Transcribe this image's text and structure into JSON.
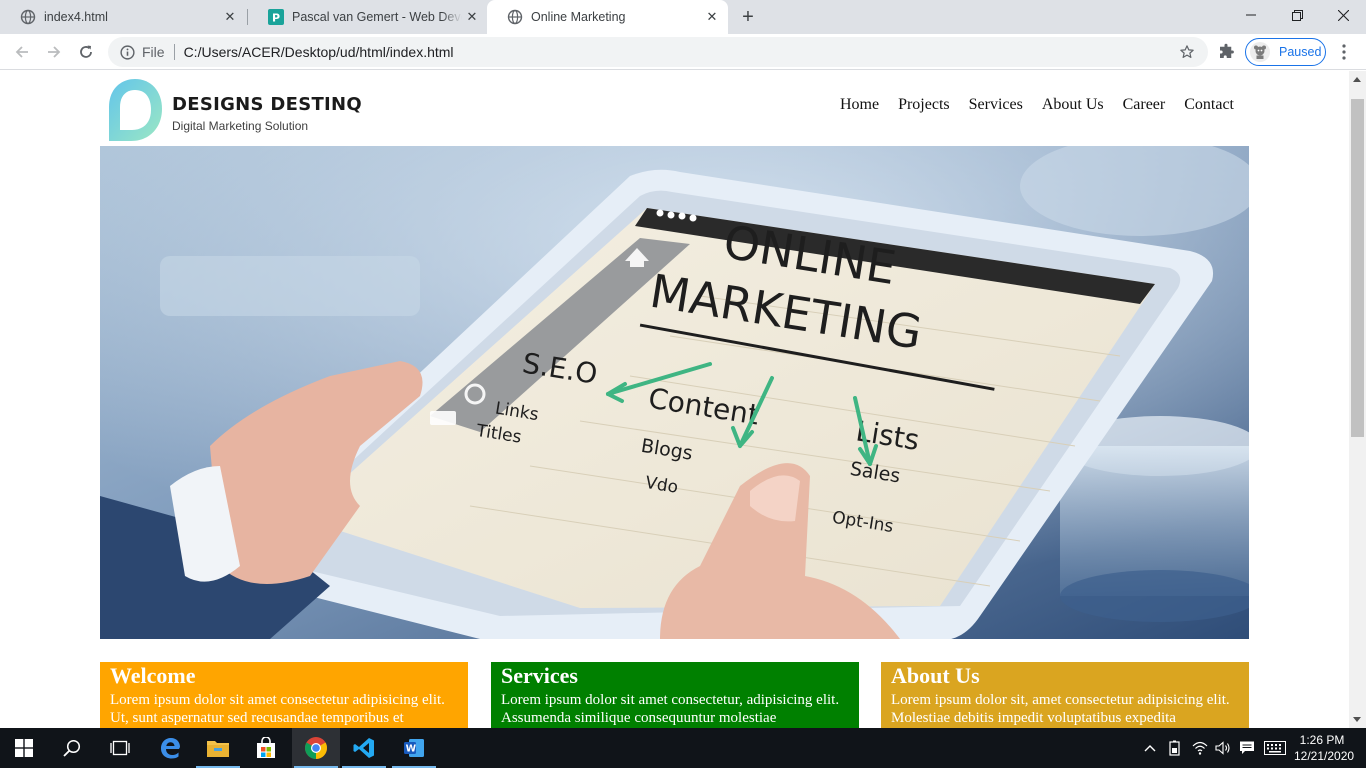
{
  "browser": {
    "tabs": [
      {
        "title": "index4.html",
        "icon": "globe-icon",
        "active": false
      },
      {
        "title": "Pascal van Gemert - Web Develop",
        "icon": "p-favicon-icon",
        "active": false
      },
      {
        "title": "Online Marketing",
        "icon": "globe-icon",
        "active": true
      }
    ],
    "new_tab_label": "+",
    "omnibox": {
      "scheme_label": "File",
      "url": "C:/Users/ACER/Desktop/ud/html/index.html"
    },
    "profile_label": "Paused",
    "colors": {
      "tabstrip": "#dee1e6",
      "accent": "#1a73e8"
    }
  },
  "site": {
    "logo": {
      "name": "DESIGNS DESTINQ",
      "tagline": "Digital Marketing Solution",
      "colors": [
        "#6fc7e8",
        "#8ee5c2"
      ]
    },
    "nav": [
      "Home",
      "Projects",
      "Services",
      "About Us",
      "Career",
      "Contact"
    ],
    "hero": {
      "heading": [
        "ONLINE",
        "MARKETING"
      ],
      "branches": [
        "S.E.O",
        "Content",
        "Lists"
      ],
      "sub_items": [
        "Links",
        "Titles",
        "Blogs",
        "Vdo",
        "Sales",
        "Opt-Ins"
      ]
    },
    "boxes": [
      {
        "title": "Welcome",
        "text": "Lorem ipsum dolor sit amet consectetur adipisicing elit. Ut, sunt aspernatur sed recusandae temporibus et",
        "color": "#ffa500"
      },
      {
        "title": "Services",
        "text": "Lorem ipsum dolor sit amet consectetur, adipisicing elit. Assumenda similique consequuntur molestiae",
        "color": "#008000"
      },
      {
        "title": "About Us",
        "text": "Lorem ipsum dolor sit, amet consectetur adipisicing elit. Molestiae debitis impedit voluptatibus expedita",
        "color": "#daa520"
      }
    ]
  },
  "taskbar": {
    "time": "1:26 PM",
    "date": "12/21/2020",
    "apps": [
      "start-icon",
      "search-icon",
      "task-view-icon",
      "edge-icon",
      "file-explorer-icon",
      "store-icon",
      "chrome-icon",
      "vscode-icon",
      "word-icon"
    ]
  }
}
